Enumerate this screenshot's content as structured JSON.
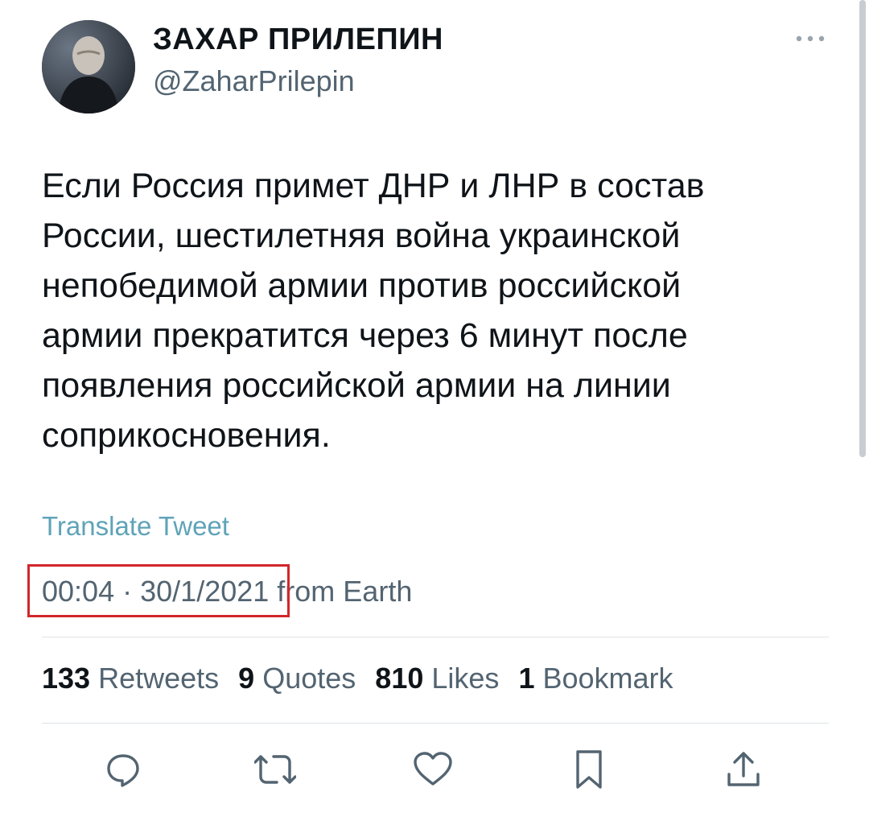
{
  "profile": {
    "display_name": "ЗАХАР ПРИЛЕПИН",
    "handle": "@ZaharPrilepin"
  },
  "tweet": {
    "text_lines": [
      "Если Россия примет ДНР и ЛНР в состав",
      "России, шестилетняя война украинской",
      "непобедимой армии против российской",
      "армии прекратится через 6 минут после",
      "появления российской армии на линии",
      "соприкосновения."
    ],
    "translate_label": "Translate Tweet",
    "time": "00:04",
    "separator": "·",
    "date": "30/1/2021",
    "source": "from Earth"
  },
  "stats": {
    "retweets_count": "133",
    "retweets_label": "Retweets",
    "quotes_count": "9",
    "quotes_label": "Quotes",
    "likes_count": "810",
    "likes_label": "Likes",
    "bookmarks_count": "1",
    "bookmarks_label": "Bookmark"
  },
  "icons": {
    "more": "more-icon",
    "reply": "reply-icon",
    "retweet": "retweet-icon",
    "like": "heart-icon",
    "bookmark": "bookmark-icon",
    "share": "share-icon"
  },
  "colors": {
    "text": "#0f1419",
    "secondary": "#536471",
    "translate_link": "#5fa3b8",
    "highlight_box": "#d1262b"
  }
}
